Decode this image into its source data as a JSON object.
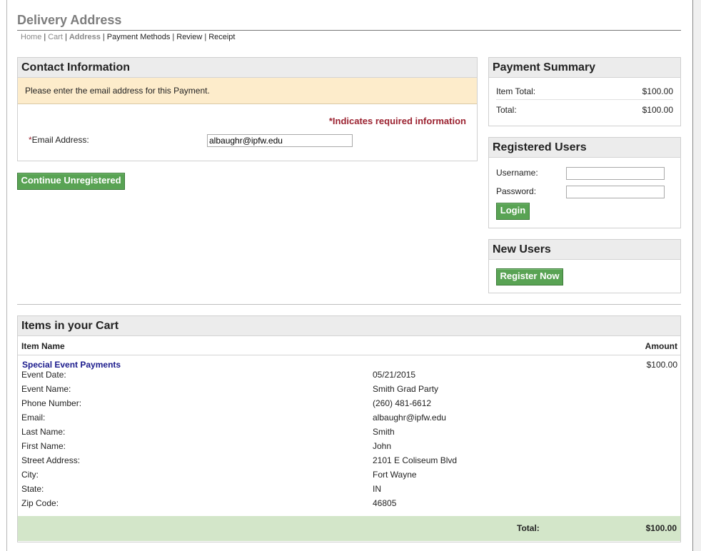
{
  "page": {
    "title": "Delivery Address",
    "breadcrumbs": [
      {
        "label": "Home",
        "state": "done"
      },
      {
        "label": "Cart",
        "state": "done"
      },
      {
        "label": "Address",
        "state": "current"
      },
      {
        "label": "Payment Methods",
        "state": "upcoming"
      },
      {
        "label": "Review",
        "state": "upcoming"
      },
      {
        "label": "Receipt",
        "state": "upcoming"
      }
    ],
    "breadcrumb_separator": "|"
  },
  "contact": {
    "heading": "Contact Information",
    "notice": "Please enter the email address for this Payment.",
    "required_note": "*Indicates required information",
    "required_marker": "*",
    "email_label": "Email Address:",
    "email_value": "albaughr@ipfw.edu"
  },
  "continue_button": "Continue Unregistered",
  "payment_summary": {
    "heading": "Payment Summary",
    "item_total_label": "Item Total:",
    "item_total_value": "$100.00",
    "total_label": "Total:",
    "total_value": "$100.00"
  },
  "registered": {
    "heading": "Registered Users",
    "username_label": "Username:",
    "username_value": "",
    "password_label": "Password:",
    "password_value": "",
    "login_button": "Login"
  },
  "new_users": {
    "heading": "New Users",
    "register_button": "Register Now"
  },
  "cart": {
    "heading": "Items in your Cart",
    "col_item": "Item Name",
    "col_amount": "Amount",
    "item_name": "Special Event Payments",
    "item_amount": "$100.00",
    "details": [
      {
        "label": "Event Date:",
        "value": "05/21/2015"
      },
      {
        "label": "Event Name:",
        "value": "Smith Grad Party"
      },
      {
        "label": "Phone Number:",
        "value": "(260) 481-6612"
      },
      {
        "label": "Email:",
        "value": "albaughr@ipfw.edu"
      },
      {
        "label": "Last Name:",
        "value": "Smith"
      },
      {
        "label": "First Name:",
        "value": "John"
      },
      {
        "label": "Street Address:",
        "value": "2101 E Coliseum Blvd"
      },
      {
        "label": "City:",
        "value": "Fort Wayne"
      },
      {
        "label": "State:",
        "value": "IN"
      },
      {
        "label": "Zip Code:",
        "value": "46805"
      }
    ],
    "total_label": "Total:",
    "total_value": "$100.00"
  }
}
